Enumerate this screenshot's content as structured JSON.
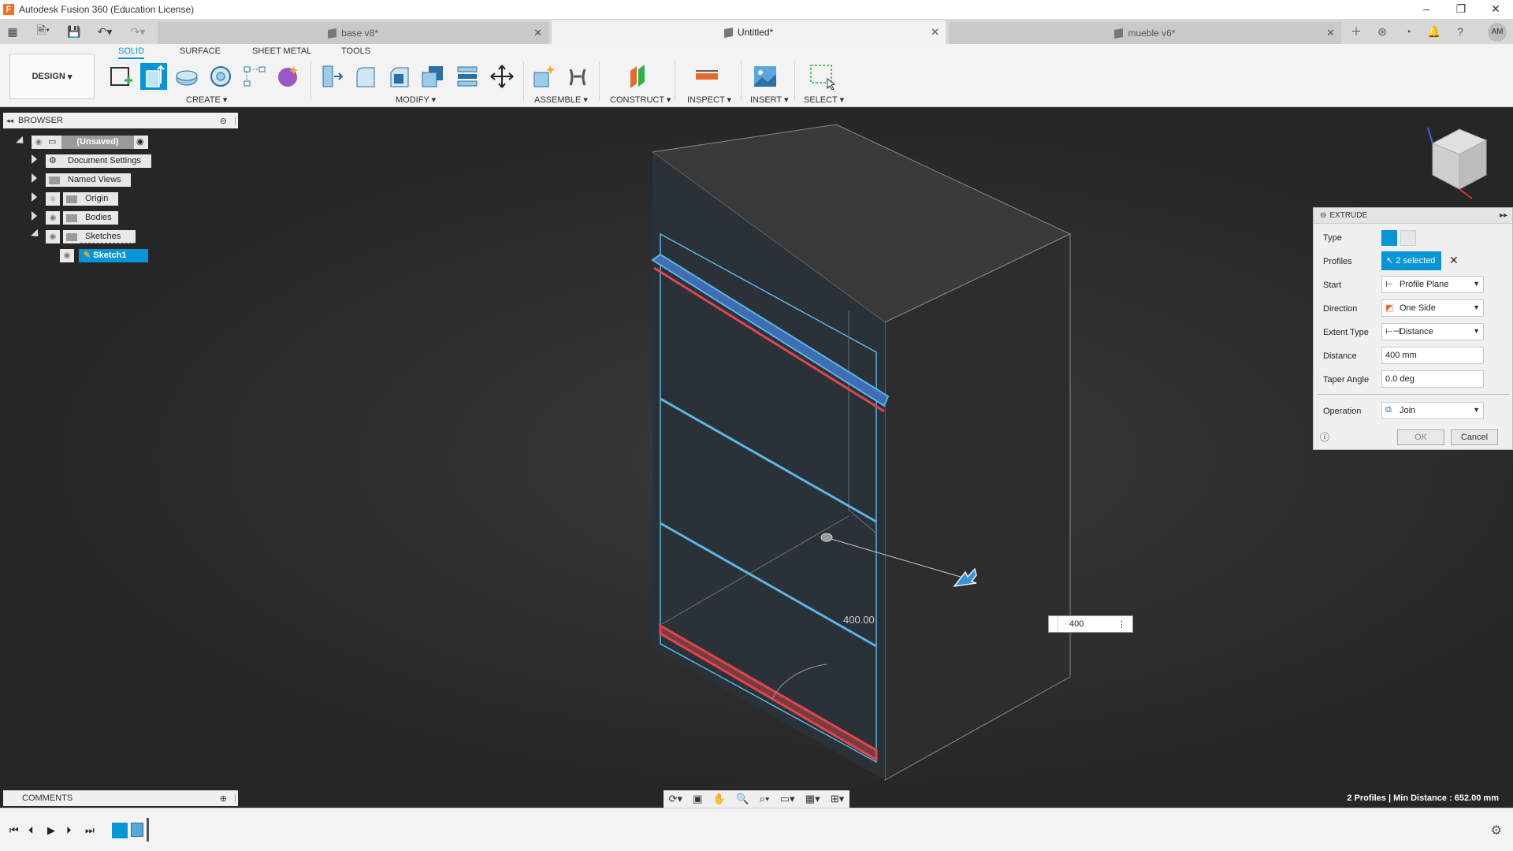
{
  "app": {
    "title": "Autodesk Fusion 360 (Education License)",
    "logo_letter": "F",
    "user_initials": "AM"
  },
  "tabs": [
    {
      "label": "base v8*",
      "active": false
    },
    {
      "label": "Untitled*",
      "active": true
    },
    {
      "label": "mueble v6*",
      "active": false
    }
  ],
  "ribbon": {
    "workspace": "DESIGN",
    "workspace_tabs": [
      "SOLID",
      "SURFACE",
      "SHEET METAL",
      "TOOLS"
    ],
    "groups": [
      "CREATE",
      "MODIFY",
      "ASSEMBLE",
      "CONSTRUCT",
      "INSPECT",
      "INSERT",
      "SELECT"
    ]
  },
  "browser": {
    "title": "BROWSER",
    "root": "(Unsaved)",
    "items": [
      "Document Settings",
      "Named Views",
      "Origin",
      "Bodies",
      "Sketches"
    ],
    "sketch": "Sketch1"
  },
  "comments": {
    "title": "COMMENTS"
  },
  "extrude": {
    "title": "EXTRUDE",
    "type_label": "Type",
    "profiles_label": "Profiles",
    "profiles_value": "2 selected",
    "start_label": "Start",
    "start_value": "Profile Plane",
    "direction_label": "Direction",
    "direction_value": "One Side",
    "extent_label": "Extent Type",
    "extent_value": "Distance",
    "distance_label": "Distance",
    "distance_value": "400 mm",
    "taper_label": "Taper Angle",
    "taper_value": "0.0 deg",
    "operation_label": "Operation",
    "operation_value": "Join",
    "ok": "OK",
    "cancel": "Cancel"
  },
  "viewport": {
    "dimension_label": "400.00",
    "input_value": "400"
  },
  "status": "2 Profiles | Min Distance : 652.00 mm",
  "colors": {
    "accent": "#0696d7",
    "selection_red": "#e0454f",
    "sketch_blue": "#5ab4e6"
  }
}
